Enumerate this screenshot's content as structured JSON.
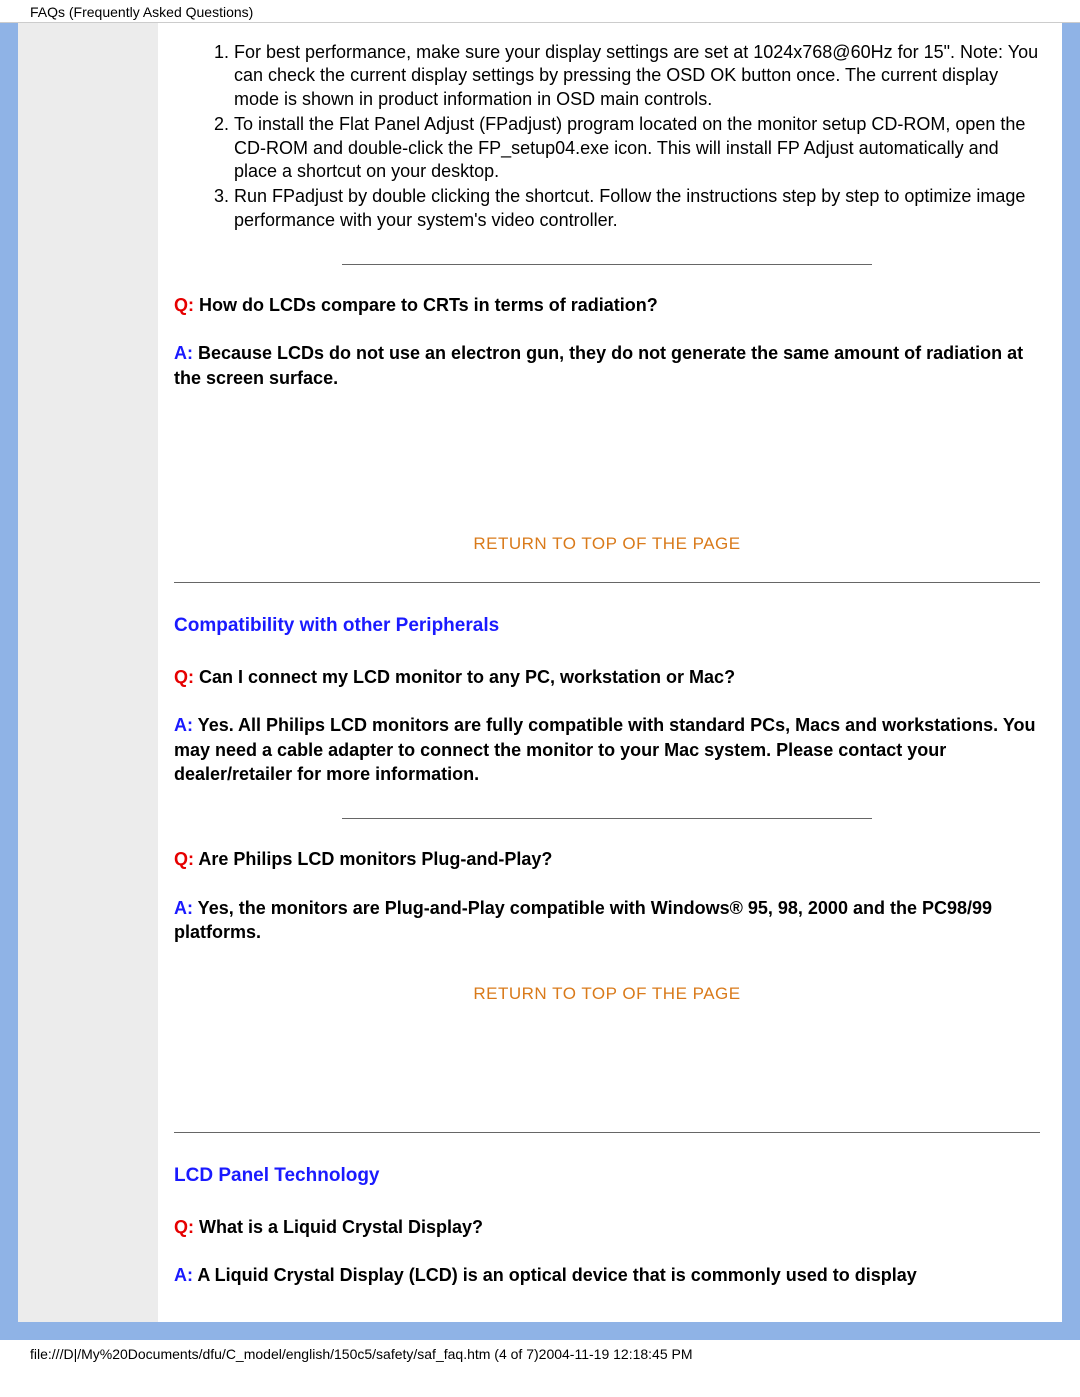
{
  "header_title": "FAQs (Frequently Asked Questions)",
  "ordered_list": [
    "For best performance, make sure your display settings are set at 1024x768@60Hz for 15\". Note: You can check the current display settings by pressing the OSD OK button once. The current display mode is shown in product information in OSD main controls.",
    "To install the Flat Panel Adjust (FPadjust) program located on the monitor setup CD-ROM, open the CD-ROM and double-click the FP_setup04.exe icon. This will install FP Adjust automatically and place a shortcut on your desktop.",
    "Run FPadjust by double clicking the shortcut. Follow the instructions step by step to optimize image performance with your system's video controller."
  ],
  "labels": {
    "q": "Q:",
    "a": "A:"
  },
  "qa1": {
    "q": " How do LCDs compare to CRTs in terms of radiation?",
    "a": " Because LCDs do not use an electron gun, they do not generate the same amount of radiation at the screen surface."
  },
  "return_link": "RETURN TO TOP OF THE PAGE",
  "section2_title": "Compatibility with other Peripherals",
  "qa2": {
    "q": " Can I connect my LCD monitor to any PC, workstation or Mac?",
    "a": " Yes. All Philips LCD monitors are fully compatible with standard PCs, Macs and workstations. You may need a cable adapter to connect the monitor to your Mac system. Please contact your dealer/retailer for more information."
  },
  "qa3": {
    "q": " Are Philips LCD monitors Plug-and-Play?",
    "a": " Yes, the monitors are Plug-and-Play compatible with Windows® 95, 98, 2000 and the PC98/99 platforms."
  },
  "section3_title": "LCD Panel Technology",
  "qa4": {
    "q": " What is a Liquid Crystal Display?",
    "a": " A Liquid Crystal Display (LCD) is an optical device that is commonly used to display"
  },
  "footer_text": "file:///D|/My%20Documents/dfu/C_model/english/150c5/safety/saf_faq.htm (4 of 7)2004-11-19 12:18:45 PM"
}
